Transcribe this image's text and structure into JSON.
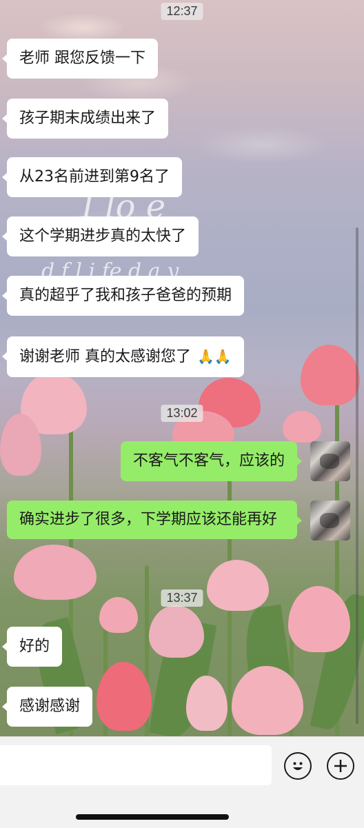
{
  "chat": {
    "timestamps": [
      "12:37",
      "13:02",
      "13:37"
    ],
    "messages": [
      {
        "side": "left",
        "text": "老师 跟您反馈一下"
      },
      {
        "side": "left",
        "text": "孩子期末成绩出来了"
      },
      {
        "side": "left",
        "text": "从23名前进到第9名了"
      },
      {
        "side": "left",
        "text": "这个学期进步真的太快了"
      },
      {
        "side": "left",
        "text": "真的超乎了我和孩子爸爸的预期"
      },
      {
        "side": "left",
        "text": "谢谢老师 真的太感谢您了",
        "emoji": "🙏🙏"
      },
      {
        "side": "right",
        "text": "不客气不客气，应该的"
      },
      {
        "side": "right",
        "text": "确实进步了很多，下学期应该还能再好"
      },
      {
        "side": "left",
        "text": "好的"
      },
      {
        "side": "left",
        "text": "感谢感谢"
      }
    ]
  },
  "wallpaper": {
    "script_text": [
      "I lo   e",
      "d        f       l  i fe       d  a y"
    ]
  },
  "input_bar": {
    "value": "",
    "placeholder": "",
    "emoji_icon": "emoji-smile-icon",
    "add_icon": "plus-icon"
  },
  "colors": {
    "sent_bubble": "#95ec69",
    "received_bubble": "#ffffff",
    "timestamp_bg": "#e8e8e8"
  }
}
